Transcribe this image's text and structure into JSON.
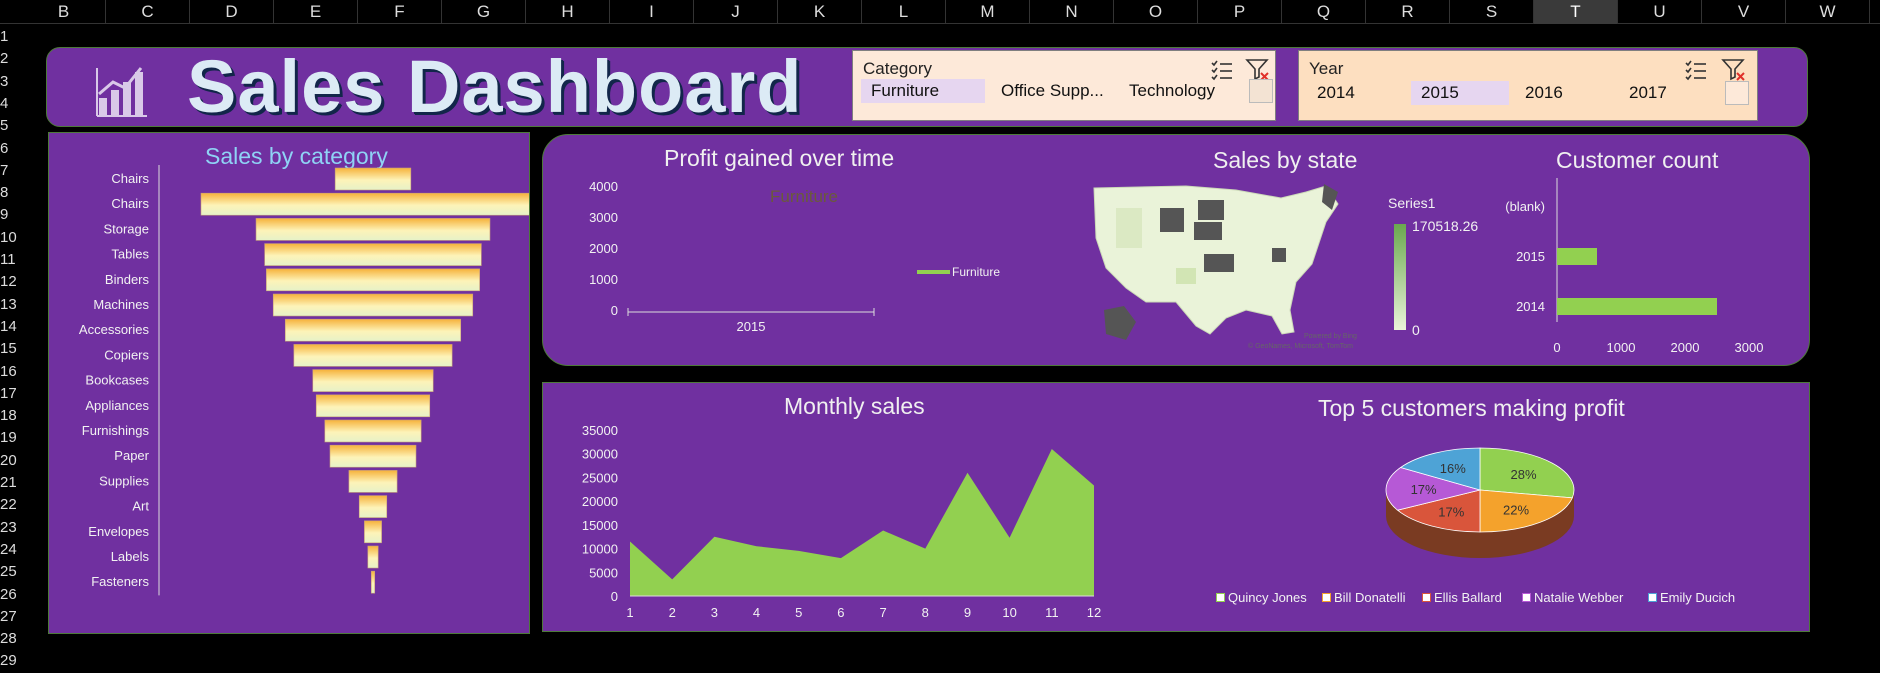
{
  "columns": [
    "B",
    "C",
    "D",
    "E",
    "F",
    "G",
    "H",
    "I",
    "J",
    "K",
    "L",
    "M",
    "N",
    "O",
    "P",
    "Q",
    "R",
    "S",
    "T",
    "U",
    "V",
    "W"
  ],
  "selected_column": "T",
  "rows": [
    "1",
    "2",
    "3",
    "4",
    "5",
    "6",
    "7",
    "8",
    "9",
    "10",
    "11",
    "12",
    "13",
    "14",
    "15",
    "16",
    "17",
    "18",
    "19",
    "20",
    "21",
    "22",
    "23",
    "24",
    "25",
    "26",
    "27",
    "28",
    "29"
  ],
  "header": {
    "title": "Sales Dashboard"
  },
  "category_slicer": {
    "label": "Category",
    "items": [
      "Furniture",
      "Office Supp...",
      "Technology"
    ],
    "selected": "Furniture"
  },
  "year_slicer": {
    "label": "Year",
    "items": [
      "2014",
      "2015",
      "2016",
      "2017"
    ],
    "selected": "2015"
  },
  "sales_by_category": {
    "title": "Sales by category",
    "chart_data": {
      "type": "bar",
      "categories": [
        "Chairs",
        "Chairs",
        "Storage",
        "Tables",
        "Binders",
        "Machines",
        "Accessories",
        "Copiers",
        "Bookcases",
        "Appliances",
        "Furnishings",
        "Paper",
        "Supplies",
        "Art",
        "Envelopes",
        "Labels",
        "Fasteners"
      ],
      "values": [
        22,
        100,
        68,
        63,
        62,
        58,
        51,
        46,
        35,
        33,
        28,
        25,
        14,
        8,
        5,
        3,
        1
      ]
    }
  },
  "profit_over_time": {
    "title": "Profit gained over time",
    "chart_data": {
      "type": "line",
      "categories": [
        "2015"
      ],
      "yticks": [
        "4000",
        "3000",
        "2000",
        "1000",
        "0"
      ],
      "ylim": [
        0,
        4000
      ],
      "series_title": "Furniture",
      "legend": "Furniture"
    }
  },
  "sales_by_state": {
    "title": "Sales by state",
    "legend_title": "Series1",
    "legend_max": "170518.26",
    "legend_min": "0",
    "credit_1": "Powered by Bing",
    "credit_2": "© GeoNames, Microsoft, TomTom"
  },
  "customer_count": {
    "title": "Customer count",
    "chart_data": {
      "type": "bar",
      "categories": [
        "(blank)",
        "2015",
        "2014"
      ],
      "values": [
        0,
        500,
        2000
      ],
      "xticks": [
        "0",
        "1000",
        "2000",
        "3000"
      ],
      "xlim": [
        0,
        3000
      ]
    }
  },
  "monthly_sales": {
    "title": "Monthly sales",
    "chart_data": {
      "type": "area",
      "x": [
        1,
        2,
        3,
        4,
        5,
        6,
        7,
        8,
        9,
        10,
        11,
        12
      ],
      "values": [
        11500,
        3500,
        12500,
        10500,
        9500,
        8000,
        13800,
        10000,
        26000,
        12300,
        31000,
        23300
      ],
      "yticks": [
        "35000",
        "30000",
        "25000",
        "20000",
        "15000",
        "10000",
        "5000",
        "0"
      ],
      "ylim": [
        0,
        35000
      ]
    }
  },
  "top_customers": {
    "title": "Top 5 customers making profit",
    "chart_data": {
      "type": "pie",
      "labels": [
        "Quincy Jones",
        "Bill Donatelli",
        "Ellis Ballard",
        "Natalie Webber",
        "Emily Ducich"
      ],
      "values": [
        28,
        22,
        17,
        17,
        16
      ],
      "value_labels": [
        "28%",
        "22%",
        "17%",
        "17%",
        "16%"
      ],
      "colors": [
        "#92d050",
        "#f4a22c",
        "#d9553b",
        "#b659d6",
        "#4ea3d6"
      ]
    }
  }
}
